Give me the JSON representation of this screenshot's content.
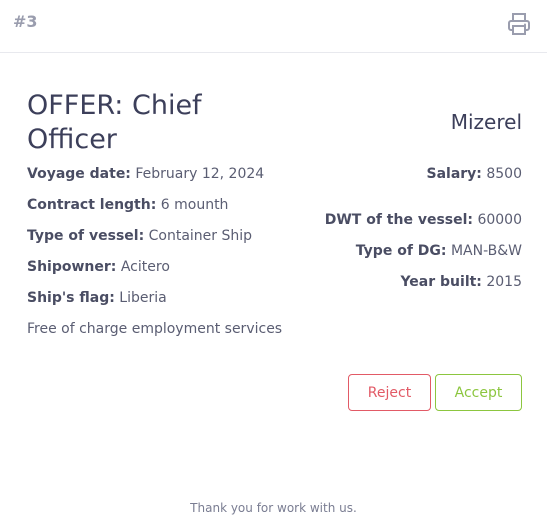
{
  "header": {
    "offer_number": "#3",
    "print_icon": "printer-icon"
  },
  "offer": {
    "title": "OFFER: Chief Officer",
    "company": "Mizerel",
    "left_fields": [
      {
        "label": "Voyage date:",
        "value": "February 12, 2024"
      },
      {
        "label": "Contract length:",
        "value": "6 mounth"
      },
      {
        "label": "Type of vessel:",
        "value": "Container Ship"
      },
      {
        "label": "Shipowner:",
        "value": "Acitero"
      },
      {
        "label": "Ship's flag:",
        "value": "Liberia"
      }
    ],
    "note": "Free of charge employment services",
    "right_fields": [
      {
        "label": "Salary:",
        "value": "8500"
      },
      {
        "label": "DWT of the vessel:",
        "value": "60000"
      },
      {
        "label": "Type of DG:",
        "value": "MAN-B&W"
      },
      {
        "label": "Year built:",
        "value": "2015"
      }
    ]
  },
  "actions": {
    "reject_label": "Reject",
    "accept_label": "Accept"
  },
  "footer": {
    "text": "Thank you for work with us."
  },
  "colors": {
    "reject": "#e25a66",
    "accept": "#8cc63f",
    "text": "#3c3f5a"
  }
}
